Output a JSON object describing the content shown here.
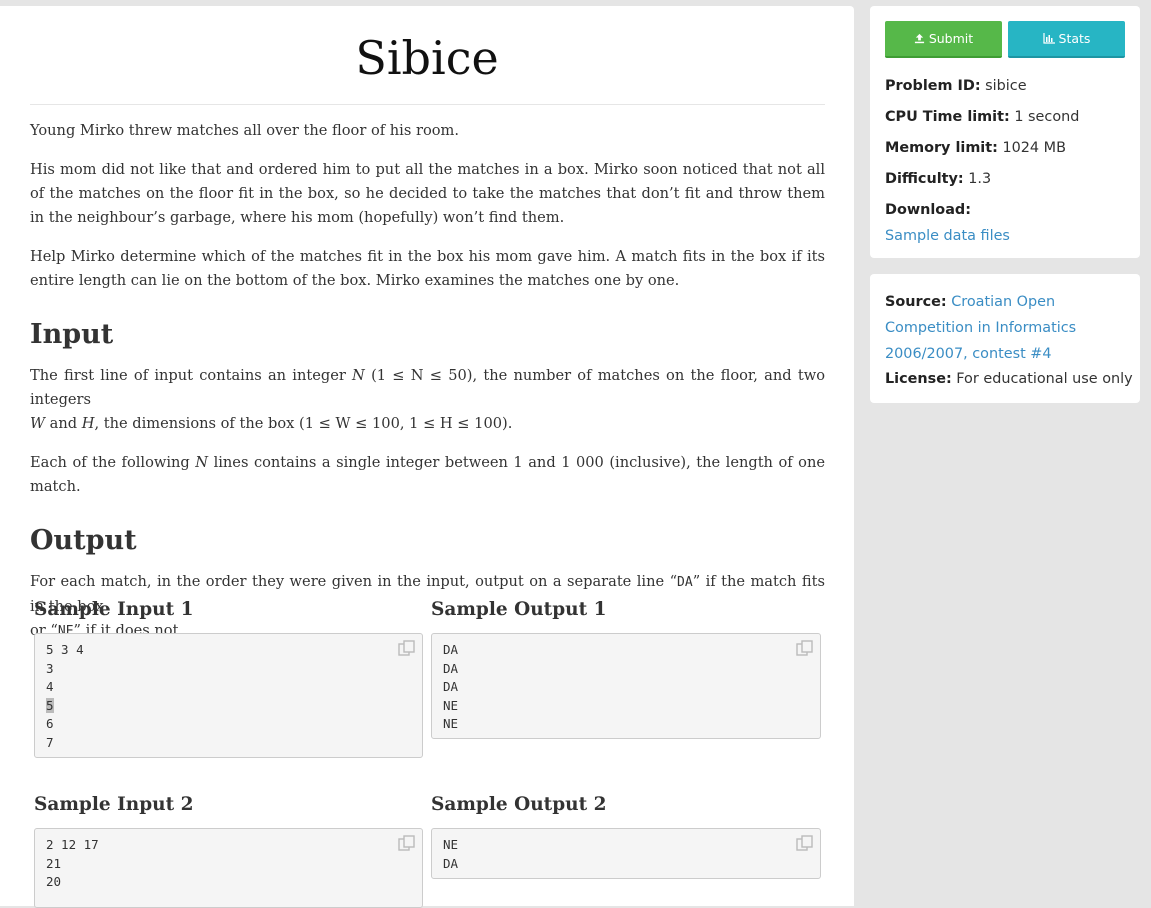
{
  "problem": {
    "title": "Sibice",
    "intro": "Young Mirko threw matches all over the floor of his room.",
    "para2": "His mom did not like that and ordered him to put all the matches in a box. Mirko soon noticed that not all of the matches on the floor fit in the box, so he decided to take the matches that don’t fit and throw them in the neighbour’s garbage, where his mom (hopefully) won’t find them.",
    "para3": "Help Mirko determine which of the matches fit in the box his mom gave him. A match fits in the box if its entire length can lie on the bottom of the box. Mirko examines the matches one by one.",
    "input_heading": "Input",
    "input_p1_a": "The first line of input contains an integer ",
    "input_p1_N": "N",
    "input_p1_range1": "(1 ≤ N ≤ 50)",
    "input_p1_b": ", the number of matches on the floor, and two integers",
    "input_p1_W": "W",
    "input_p1_and": " and ",
    "input_p1_H": "H",
    "input_p1_c": ", the dimensions of the box ",
    "input_p1_range2": "(1 ≤ W ≤ 100, 1 ≤ H ≤ 100)",
    "input_p1_end": ".",
    "input_p2_a": "Each of the following ",
    "input_p2_N": "N",
    "input_p2_b": " lines contains a single integer between ",
    "input_p2_lo": "1",
    "input_p2_and": " and ",
    "input_p2_hi": "1 000",
    "input_p2_c": " (inclusive), the length of one match.",
    "output_heading": "Output",
    "output_p_a": "For each match, in the order they were given in the input, output on a separate line “",
    "output_p_da": "DA",
    "output_p_b": "” if the match fits in the box",
    "output_p_c": "or “",
    "output_p_ne": "NE",
    "output_p_d": "” if it does not."
  },
  "samples": [
    {
      "input_title": "Sample Input 1",
      "output_title": "Sample Output 1",
      "input_lines": [
        "5 3 4",
        "3",
        "4",
        "5",
        "6",
        "7"
      ],
      "output_lines": [
        "DA",
        "DA",
        "DA",
        "NE",
        "NE"
      ]
    },
    {
      "input_title": "Sample Input 2",
      "output_title": "Sample Output 2",
      "input_lines": [
        "2 12 17",
        "21",
        "20"
      ],
      "output_lines": [
        "NE",
        "DA"
      ]
    }
  ],
  "sidebar": {
    "submit_label": "Submit",
    "stats_label": "Stats",
    "problem_id_label": "Problem ID:",
    "problem_id": "sibice",
    "cpu_label": "CPU Time limit:",
    "cpu_value": "1 second",
    "memory_label": "Memory limit:",
    "memory_value": "1024 MB",
    "difficulty_label": "Difficulty:",
    "difficulty_value": "1.3",
    "download_label": "Download:",
    "download_link": "Sample data files",
    "source_label": "Source:",
    "source_line1": "Croatian Open",
    "source_line2": "Competition in Informatics",
    "source_line3": "2006/2007, contest #4",
    "license_label": "License:",
    "license_value": "For educational use only"
  },
  "colors": {
    "submit": "#56b849",
    "stats": "#27b5c4",
    "link": "#3a8dc4",
    "page_bg": "#e5e5e5"
  },
  "icons": {
    "submit": "upload-icon",
    "stats": "bar-chart-icon",
    "copy": "copy-icon"
  }
}
